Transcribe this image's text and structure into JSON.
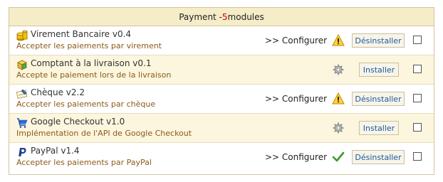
{
  "panel": {
    "title_prefix": "Payment - ",
    "count": "5",
    "title_suffix": " modules"
  },
  "modules": [
    {
      "icon": "coins-icon",
      "title": "Virement Bancaire v0.4",
      "description": "Accepter les paiements par virement",
      "configure_label": ">> Configurer",
      "status_icon": "warning-icon",
      "action_label": "Désinstaller",
      "action": "uninstall"
    },
    {
      "icon": "cash-package-icon",
      "title": "Comptant à la livraison v0.1",
      "description": "Accepte le paiement lors de la livraison",
      "configure_label": "",
      "status_icon": "gear-icon",
      "action_label": "Installer",
      "action": "install"
    },
    {
      "icon": "cheque-icon",
      "title": "Chèque v2.2",
      "description": "Accepter les paiements par chèque",
      "configure_label": ">> Configurer",
      "status_icon": "warning-icon",
      "action_label": "Désinstaller",
      "action": "uninstall"
    },
    {
      "icon": "cart-icon",
      "title": "Google Checkout v1.0",
      "description": "Implémentation de l'API de Google Checkout",
      "configure_label": "",
      "status_icon": "gear-icon",
      "action_label": "Installer",
      "action": "install"
    },
    {
      "icon": "paypal-icon",
      "title": "PayPal v1.4",
      "description": "Accepter les paiements par PayPal",
      "configure_label": ">> Configurer",
      "status_icon": "checkmark-icon",
      "action_label": "Désinstaller",
      "action": "uninstall"
    }
  ],
  "colors": {
    "header_bg": "#f5ecc8",
    "alt_row_bg": "#fbf6dd",
    "border": "#d3c59c",
    "count_red": "#d10000",
    "description_brown": "#8b5a1a",
    "button_text": "#205a9c"
  }
}
